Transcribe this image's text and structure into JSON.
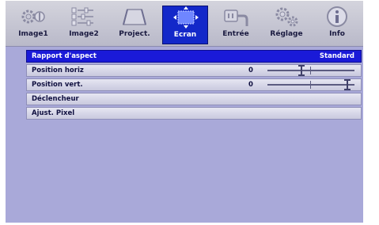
{
  "tabs": [
    {
      "label": "Image1",
      "icon": "gear-circle-icon"
    },
    {
      "label": "Image2",
      "icon": "sliders-icon"
    },
    {
      "label": "Project.",
      "icon": "projection-screen-icon"
    },
    {
      "label": "Ecran",
      "icon": "screen-position-icon",
      "active": true
    },
    {
      "label": "Entrée",
      "icon": "input-connector-icon"
    },
    {
      "label": "Réglage",
      "icon": "gears-icon"
    },
    {
      "label": "Info",
      "icon": "info-icon"
    }
  ],
  "menu": {
    "aspect": {
      "label": "Rapport d'aspect",
      "value": "Standard"
    },
    "hpos": {
      "label": "Position horiz",
      "value": "0",
      "slider_level": 0.38
    },
    "vpos": {
      "label": "Position vert.",
      "value": "0",
      "slider_level": 0.95
    },
    "trigger": {
      "label": "Déclencheur"
    },
    "pixel": {
      "label": "Ajust. Pixel"
    }
  },
  "colors": {
    "active_tab": "#1328c9",
    "active_row": "#1a1ad8",
    "background": "#a9a9d9"
  }
}
